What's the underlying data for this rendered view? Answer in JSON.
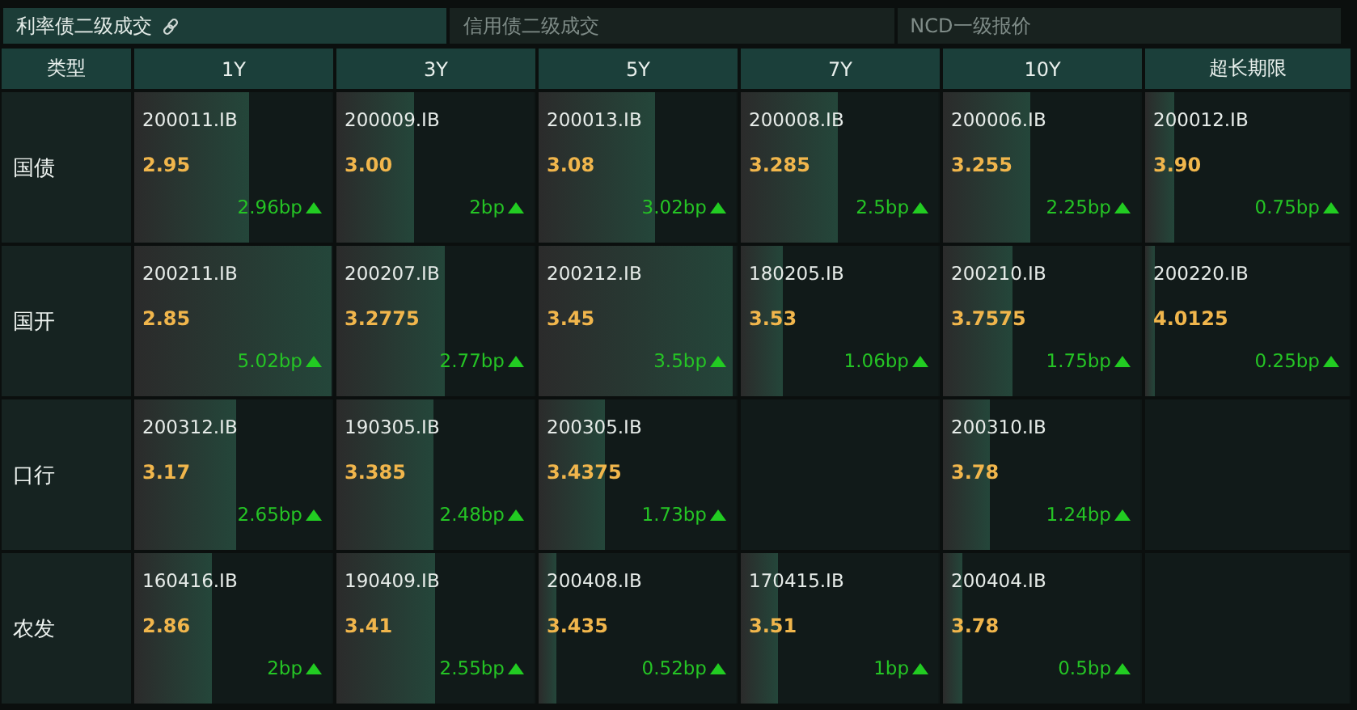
{
  "tabs": [
    {
      "label": "利率债二级成交",
      "selected": true,
      "link": true
    },
    {
      "label": "信用债二级成交",
      "selected": false,
      "link": false
    },
    {
      "label": "NCD一级报价",
      "selected": false,
      "link": false
    }
  ],
  "table": {
    "corner": "类型",
    "columns": [
      "1Y",
      "3Y",
      "5Y",
      "7Y",
      "10Y",
      "超长期限"
    ],
    "rows": [
      {
        "type": "国债",
        "cells": [
          {
            "code": "200011.IB",
            "yield": "2.95",
            "change": "2.96bp",
            "level": 0.58
          },
          {
            "code": "200009.IB",
            "yield": "3.00",
            "change": "2bp",
            "level": 0.39
          },
          {
            "code": "200013.IB",
            "yield": "3.08",
            "change": "3.02bp",
            "level": 0.59
          },
          {
            "code": "200008.IB",
            "yield": "3.285",
            "change": "2.5bp",
            "level": 0.49
          },
          {
            "code": "200006.IB",
            "yield": "3.255",
            "change": "2.25bp",
            "level": 0.44
          },
          {
            "code": "200012.IB",
            "yield": "3.90",
            "change": "0.75bp",
            "level": 0.14
          }
        ]
      },
      {
        "type": "国开",
        "cells": [
          {
            "code": "200211.IB",
            "yield": "2.85",
            "change": "5.02bp",
            "level": 1
          },
          {
            "code": "200207.IB",
            "yield": "3.2775",
            "change": "2.77bp",
            "level": 0.55
          },
          {
            "code": "200212.IB",
            "yield": "3.45",
            "change": "3.5bp",
            "level": 0.98
          },
          {
            "code": "180205.IB",
            "yield": "3.53",
            "change": "1.06bp",
            "level": 0.21
          },
          {
            "code": "200210.IB",
            "yield": "3.7575",
            "change": "1.75bp",
            "level": 0.35
          },
          {
            "code": "200220.IB",
            "yield": "4.0125",
            "change": "0.25bp",
            "level": 0.05
          }
        ]
      },
      {
        "type": "口行",
        "cells": [
          {
            "code": "200312.IB",
            "yield": "3.17",
            "change": "2.65bp",
            "level": 0.52
          },
          {
            "code": "190305.IB",
            "yield": "3.385",
            "change": "2.48bp",
            "level": 0.49
          },
          {
            "code": "200305.IB",
            "yield": "3.4375",
            "change": "1.73bp",
            "level": 0.34
          },
          null,
          {
            "code": "200310.IB",
            "yield": "3.78",
            "change": "1.24bp",
            "level": 0.24
          },
          null
        ]
      },
      {
        "type": "农发",
        "cells": [
          {
            "code": "160416.IB",
            "yield": "2.86",
            "change": "2bp",
            "level": 0.39
          },
          {
            "code": "190409.IB",
            "yield": "3.41",
            "change": "2.55bp",
            "level": 0.5
          },
          {
            "code": "200408.IB",
            "yield": "3.435",
            "change": "0.52bp",
            "level": 0.09
          },
          {
            "code": "170415.IB",
            "yield": "3.51",
            "change": "1bp",
            "level": 0.19
          },
          {
            "code": "200404.IB",
            "yield": "3.78",
            "change": "0.5bp",
            "level": 0.1
          },
          null
        ]
      }
    ]
  }
}
